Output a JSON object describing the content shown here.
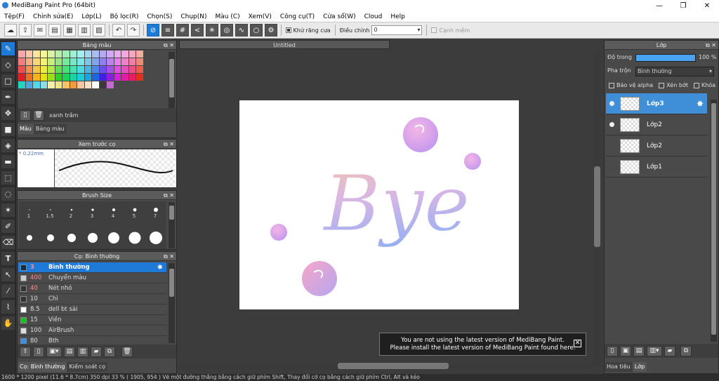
{
  "window": {
    "title": "MediBang Paint Pro (64bit)"
  },
  "menu": [
    "Tệp(F)",
    "Chỉnh sửa(E)",
    "Lớp(L)",
    "Bộ lọc(R)",
    "Chọn(S)",
    "Chụp(N)",
    "Màu (C)",
    "Xem(V)",
    "Công cụ(T)",
    "Cửa sổ(W)",
    "Cloud",
    "Help"
  ],
  "toolbar": {
    "antialias_label": "Khử răng cưa",
    "adjust_label": "Điều chỉnh",
    "adjust_value": "0",
    "smooth_edge_label": "Cạnh mềm"
  },
  "palette_panel": {
    "title": "Bảng màu",
    "color_name": "xanh trầm",
    "tabs": [
      "Màu",
      "Bảng màu"
    ],
    "colors": [
      "#f7a6a6",
      "#f9c9a4",
      "#fbe49e",
      "#f6f59f",
      "#d8f49f",
      "#b6f0a2",
      "#a1efb4",
      "#a2efd4",
      "#a3eef0",
      "#a3d7f2",
      "#a7bdf3",
      "#b4a9f3",
      "#d1a9f2",
      "#eea8f1",
      "#f1a8dc",
      "#f2a8bf",
      "#f1ad9e",
      "#f27d7d",
      "#f8ae7d",
      "#fad67a",
      "#f3f07a",
      "#c8ef7a",
      "#93e97e",
      "#7ae89a",
      "#7be7c6",
      "#7be5ea",
      "#7cc7ec",
      "#7ea5ee",
      "#9081ee",
      "#bb81ed",
      "#e880ec",
      "#ed7fcb",
      "#ee80a4",
      "#ed8a7a",
      "#ee4e4e",
      "#f58e4e",
      "#f8c54c",
      "#eee94b",
      "#b3e84b",
      "#5fdf52",
      "#4bdf79",
      "#4cdeb5",
      "#4cdbe2",
      "#4db5e5",
      "#4f86e8",
      "#6a50e8",
      "#a451e7",
      "#e14fe6",
      "#e74fb8",
      "#e85185",
      "#e85f4c",
      "#e31d1d",
      "#f06f1d",
      "#f6b31b",
      "#e6e01a",
      "#99df1a",
      "#2bd323",
      "#1ad357",
      "#1bd2a2",
      "#1bcfd9",
      "#1ca2dd",
      "#1e66df",
      "#431fe0",
      "#8c1fdf",
      "#d91ddd",
      "#df1ea4",
      "#e01f64",
      "#e0321b",
      "#22d1bf",
      "#4ca6e3",
      "#56d6e8",
      "#8edbe3",
      "#f3f1a8",
      "#f1e67d",
      "#f7c36a",
      "#ef9b42",
      "#f6c6a0",
      "#fbe2c7",
      "#ffffff",
      "#3a3a3a",
      "#c36ad0"
    ]
  },
  "preview_panel": {
    "title": "Xem trước cọ",
    "size_text": "0.22mm"
  },
  "brush_size_panel": {
    "title": "Brush Size",
    "labels": [
      "1",
      "1.5",
      "2",
      "3",
      "4",
      "5",
      "7"
    ]
  },
  "brush_panel": {
    "title": "Cọ: Bình thường",
    "items": [
      {
        "size": "3",
        "name": "Bình thường",
        "color": "#1a2a3a"
      },
      {
        "size": "400",
        "name": "Chuyển màu",
        "color": "#cccccc"
      },
      {
        "size": "40",
        "name": "Nét nhỏ",
        "color": "#333333"
      },
      {
        "size": "10",
        "name": "Chì",
        "color": "#333333"
      },
      {
        "size": "8.5",
        "name": "dell bt sài",
        "color": "#ffffff"
      },
      {
        "size": "15",
        "name": "Viền",
        "color": "#22bb22"
      },
      {
        "size": "100",
        "name": "AirBrush",
        "color": "#dddddd"
      },
      {
        "size": "80",
        "name": "Bth",
        "color": "#3b8fe0"
      }
    ],
    "tabs": [
      "Cọ: Bình thường",
      "Kiểm soát cọ"
    ]
  },
  "document": {
    "tab_title": "Untitled"
  },
  "notice": {
    "line1": "You are not using the latest version of MediBang Paint.",
    "line2": "Please install the latest version of MediBang Paint found here."
  },
  "layer_panel": {
    "title": "Lớp",
    "opacity_label": "Độ trong",
    "opacity_value": "100 %",
    "opacity_level": 1.0,
    "blend_label": "Pha trộn",
    "blend_value": "Bình thường",
    "protect_alpha": "Bảo vệ alpha",
    "clip": "Xén bớt",
    "lock": "Khóa",
    "layers": [
      "Lớp3",
      "Lớp2",
      "Lớp2",
      "Lớp1"
    ],
    "tabs": [
      "Hoa tiêu",
      "Lớp"
    ]
  },
  "status": "1600 * 1200 pixel   (11.6 * 8.7cm)   350 dpi   33 %   ( 1905, 954 )   Vẽ một đường thẳng bằng cách giữ phím Shift, Thay đổi cỡ cọ bằng cách giữ phím Ctrl, Alt và kéo",
  "artwork": {
    "word": "Bye"
  }
}
